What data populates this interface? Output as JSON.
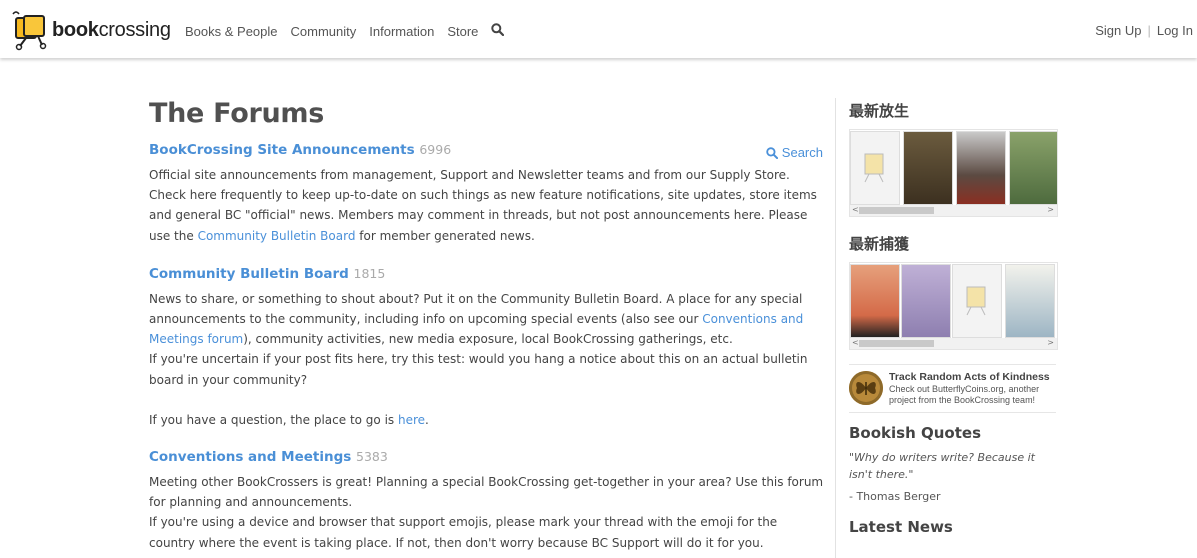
{
  "header": {
    "logo_text_bold": "book",
    "logo_text_rest": "crossing",
    "nav": [
      "Books & People",
      "Community",
      "Information",
      "Store"
    ],
    "signup": "Sign Up",
    "separator": "|",
    "login": "Log In"
  },
  "main": {
    "title": "The Forums",
    "search_label": "Search",
    "forums": [
      {
        "title": "BookCrossing Site Announcements",
        "count": "6996",
        "text_before": "Official site announcements from management, Support and Newsletter teams and from our Supply Store. Check here frequently to keep up-to-date on such things as new feature notifications, site updates, store items and general BC \"official\" news. Members may comment in threads, but not post announcements here. Please use the ",
        "link": "Community Bulletin Board",
        "text_after": " for member generated news."
      },
      {
        "title": "Community Bulletin Board",
        "count": "1815",
        "p1_before": "News to share, or something to shout about? Put it on the Community Bulletin Board. A place for any special announcements to the community, including info on upcoming special events (also see our ",
        "p1_link": "Conventions and Meetings forum",
        "p1_after": "), community activities, new media exposure, local BookCrossing gatherings, etc.",
        "p2": "If you're uncertain if your post fits here, try this test: would you hang a notice about this on an actual bulletin board in your community?",
        "p3_before": "If you have a question, the place to go is ",
        "p3_link": "here",
        "p3_after": "."
      },
      {
        "title": "Conventions and Meetings",
        "count": "5383",
        "p1": "Meeting other BookCrossers is great! Planning a special BookCrossing get-together in your area? Use this forum for planning and announcements.",
        "p2": "If you're using a device and browser that support emojis, please mark your thread with the emoji for the country where the event is taking place. If not, then don't worry because BC Support will do it for you."
      }
    ]
  },
  "sidebar": {
    "latest_released_title": "最新放生",
    "latest_caught_title": "最新捕獲",
    "scroll_left": "<",
    "scroll_right": ">",
    "rak_title": "Track Random Acts of Kindness",
    "rak_desc": "Check out ButterflyCoins.org, another project from the BookCrossing team!",
    "quotes_title": "Bookish Quotes",
    "quote": "\"Why do writers write? Because it isn't there.\"",
    "quote_author": "- Thomas Berger",
    "news_title": "Latest News"
  },
  "colors": {
    "link": "#4a8fd6",
    "title": "#505050",
    "count": "#aaaaaa",
    "rak_gold": "#b8893a"
  },
  "icons": {
    "search": "search-icon",
    "logo": "logo-book-icon",
    "butterfly": "butterfly-coin-icon"
  }
}
